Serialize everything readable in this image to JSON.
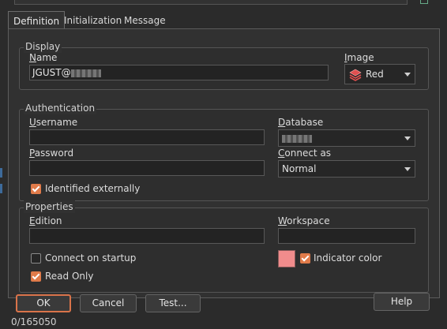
{
  "tabs": [
    "Definition",
    "Initialization",
    "Message"
  ],
  "display": {
    "legend": "Display",
    "name_label": "Name",
    "name_value": "JGUST@",
    "image_label": "Image",
    "image_value": "Red"
  },
  "authentication": {
    "legend": "Authentication",
    "username_label": "Username",
    "username_value": "",
    "password_label": "Password",
    "password_value": "",
    "database_label": "Database",
    "connect_as_label": "Connect as",
    "connect_as_value": "Normal",
    "identified_externally_label": "Identified externally",
    "identified_externally_checked": true
  },
  "properties": {
    "legend": "Properties",
    "edition_label": "Edition",
    "edition_value": "",
    "workspace_label": "Workspace",
    "workspace_value": "",
    "connect_on_startup_label": "Connect on startup",
    "connect_on_startup_checked": false,
    "read_only_label": "Read Only",
    "read_only_checked": true,
    "indicator_color_label": "Indicator color",
    "indicator_color_checked": true,
    "indicator_color": "#f08c8c"
  },
  "buttons": {
    "ok": "OK",
    "cancel": "Cancel",
    "test": "Test...",
    "help": "Help"
  },
  "status": {
    "text": "0/165050"
  },
  "colors": {
    "accent": "#e07b4a",
    "panel": "#313131"
  }
}
